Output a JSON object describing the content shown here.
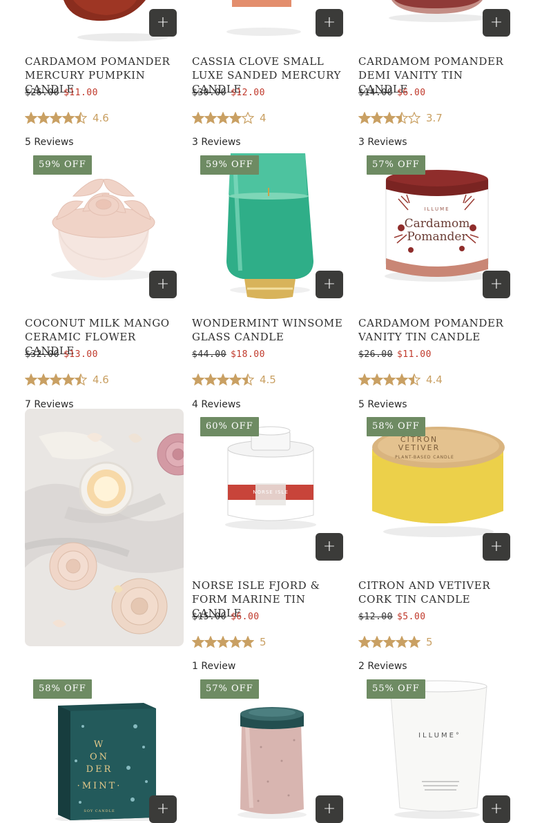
{
  "colors": {
    "badge": "#6e8b63",
    "sale_price": "#c0392b",
    "star": "#c9a063",
    "add_button": "#3b3b39"
  },
  "products": [
    {
      "title": "CARDAMOM POMANDER MERCURY PUMPKIN CANDLE",
      "old_price": "$26.00",
      "new_price": "$11.00",
      "rating": 4.6,
      "rating_text": "4.6",
      "reviews": "5 Reviews",
      "badge": "",
      "add_icon": "plus-icon"
    },
    {
      "title": "CASSIA CLOVE SMALL LUXE SANDED MERCURY CANDLE",
      "old_price": "$30.00",
      "new_price": "$12.00",
      "rating": 4,
      "rating_text": "4",
      "reviews": "3 Reviews",
      "badge": "",
      "add_icon": "plus-icon"
    },
    {
      "title": "CARDAMOM POMANDER DEMI VANITY TIN CANDLE",
      "old_price": "$14.00",
      "new_price": "$6.00",
      "rating": 3.7,
      "rating_text": "3.7",
      "reviews": "3 Reviews",
      "badge": "",
      "add_icon": "plus-icon"
    },
    {
      "title": "COCONUT MILK MANGO CERAMIC FLOWER CANDLE",
      "old_price": "$32.00",
      "new_price": "$13.00",
      "rating": 4.6,
      "rating_text": "4.6",
      "reviews": "7 Reviews",
      "badge": "59% OFF",
      "add_icon": "plus-icon"
    },
    {
      "title": "WONDERMINT WINSOME GLASS CANDLE",
      "old_price": "$44.00",
      "new_price": "$18.00",
      "rating": 4.5,
      "rating_text": "4.5",
      "reviews": "4 Reviews",
      "badge": "59% OFF",
      "add_icon": "plus-icon"
    },
    {
      "title": "CARDAMOM POMANDER VANITY TIN CANDLE",
      "old_price": "$26.00",
      "new_price": "$11.00",
      "rating": 4.4,
      "rating_text": "4.4",
      "reviews": "5 Reviews",
      "badge": "57% OFF",
      "add_icon": "plus-icon",
      "label_line1": "Cardamom",
      "label_line2": "Pomander",
      "label_brand": "ILLUME"
    },
    {
      "title": "NORSE ISLE FJORD & FORM MARINE TIN CANDLE",
      "old_price": "$15.00",
      "new_price": "$6.00",
      "rating": 5,
      "rating_text": "5",
      "reviews": "1 Review",
      "badge": "60% OFF",
      "add_icon": "plus-icon",
      "label_line1": "NORSE ISLE"
    },
    {
      "title": "CITRON AND VETIVER CORK TIN CANDLE",
      "old_price": "$12.00",
      "new_price": "$5.00",
      "rating": 5,
      "rating_text": "5",
      "reviews": "2 Reviews",
      "badge": "58% OFF",
      "add_icon": "plus-icon",
      "label_line1": "CITRON",
      "label_line2": "VETIVER",
      "label_line3": "PLANT-BASED CANDLE"
    },
    {
      "badge": "58% OFF",
      "add_icon": "plus-icon",
      "box_text": [
        "W",
        "ON",
        "DER",
        "·MINT·",
        "SOY CANDLE"
      ]
    },
    {
      "badge": "57% OFF",
      "add_icon": "plus-icon"
    },
    {
      "badge": "55% OFF",
      "add_icon": "plus-icon",
      "label_line1": "ILLUME°"
    }
  ]
}
